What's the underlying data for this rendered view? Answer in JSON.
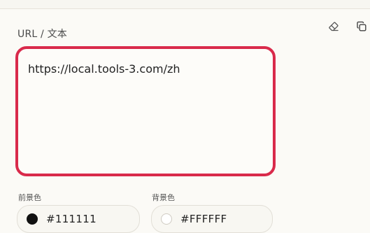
{
  "form": {
    "label": "URL / 文本",
    "content_value": "https://local.tools-3.com/zh"
  },
  "icons": {
    "clear": "eraser-icon",
    "copy": "copy-icon"
  },
  "colors": {
    "foreground": {
      "label": "前景色",
      "value": "#111111"
    },
    "background": {
      "label": "背景色",
      "value": "#FFFFFF"
    },
    "accent_border": "#d92a4b"
  }
}
